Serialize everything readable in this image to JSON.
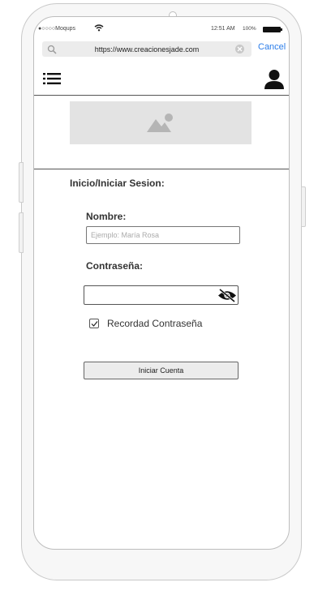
{
  "status_bar": {
    "carrier": "●○○○○Moqups",
    "time": "12:51 AM",
    "battery_percent": "100%"
  },
  "browser": {
    "url": "https://www.creacionesjade.com",
    "cancel_label": "Cancel",
    "accent_color": "#2b7de9"
  },
  "header": {
    "menu_icon": "hamburger-menu-icon",
    "user_icon": "user-icon"
  },
  "hero": {
    "image_placeholder_icon": "image-placeholder-icon"
  },
  "form": {
    "title": "Inicio/Iniciar Sesion:",
    "name_label": "Nombre:",
    "name_placeholder": "Ejemplo: María Rosa",
    "password_label": "Contraseña:",
    "password_value": "",
    "password_toggle_icon": "eye-slash-icon",
    "remember_label": "Recordad Contraseña",
    "remember_checked": true,
    "submit_label": "Iniciar Cuenta"
  }
}
